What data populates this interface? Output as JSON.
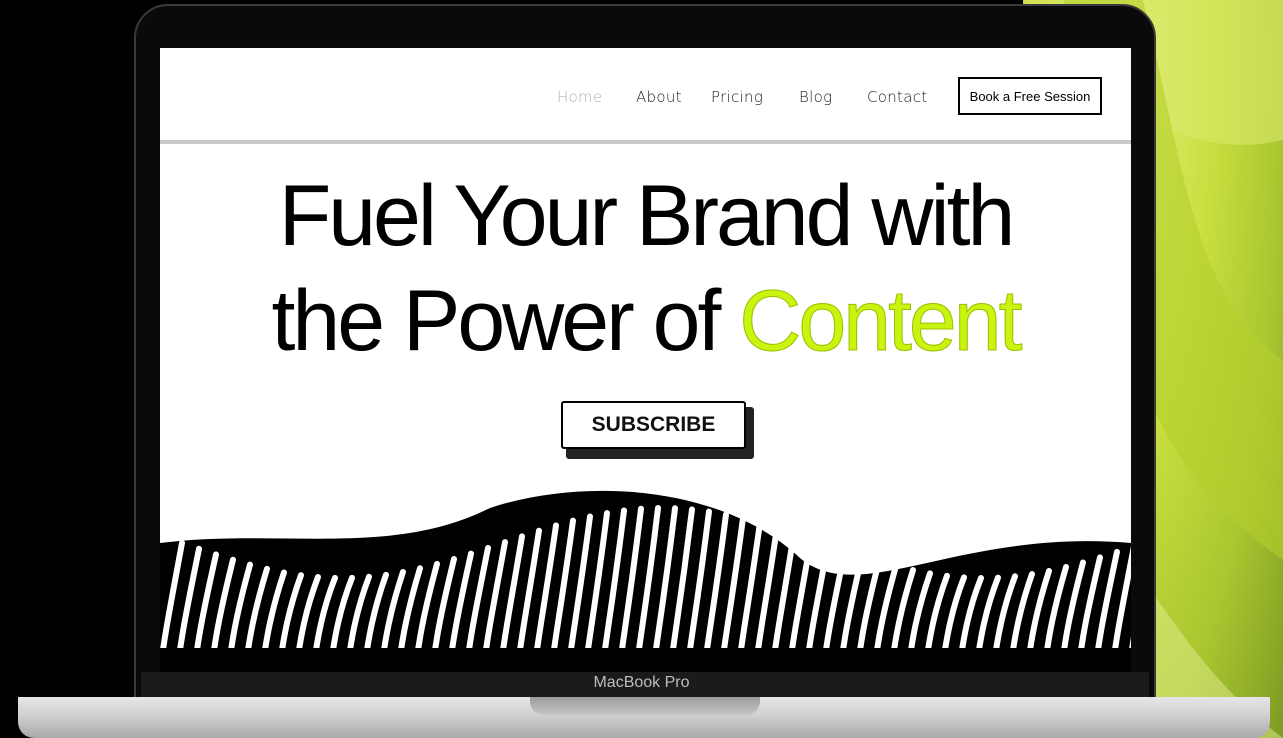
{
  "nav": {
    "items": [
      {
        "label": "Home",
        "active": true
      },
      {
        "label": "About",
        "active": false
      },
      {
        "label": "Pricing",
        "active": false
      },
      {
        "label": "Blog",
        "active": false
      },
      {
        "label": "Contact",
        "active": false
      }
    ],
    "cta_label": "Book a Free Session"
  },
  "hero": {
    "headline_line1": "Fuel Your Brand with",
    "headline_line2_prefix": "the Power of ",
    "headline_line2_accent": "Content",
    "subscribe_label": "SUBSCRIBE"
  },
  "device": {
    "label": "MacBook Pro"
  },
  "colors": {
    "accent": "#c9f40f",
    "backdrop": "#c8de3e",
    "text": "#000000"
  },
  "decor": {
    "hero_art": "black-white-striped-wave-icon"
  }
}
